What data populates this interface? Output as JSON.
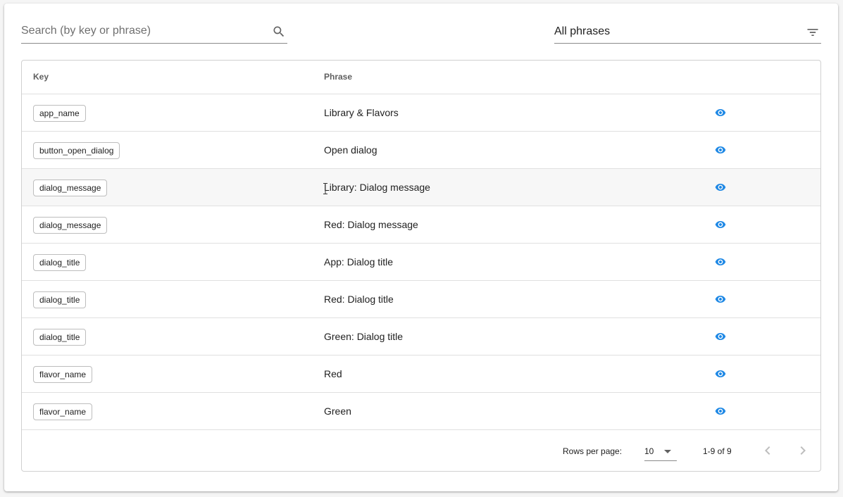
{
  "search": {
    "placeholder": "Search (by key or phrase)",
    "value": "",
    "icon": "search-icon"
  },
  "filter": {
    "selected": "All phrases",
    "icon": "filter-icon"
  },
  "table": {
    "columns": {
      "key": "Key",
      "phrase": "Phrase"
    },
    "rows": [
      {
        "key": "app_name",
        "phrase": "Library & Flavors"
      },
      {
        "key": "button_open_dialog",
        "phrase": "Open dialog"
      },
      {
        "key": "dialog_message",
        "phrase": "Library: Dialog message"
      },
      {
        "key": "dialog_message",
        "phrase": "Red: Dialog message"
      },
      {
        "key": "dialog_title",
        "phrase": "App: Dialog title"
      },
      {
        "key": "dialog_title",
        "phrase": "Red: Dialog title"
      },
      {
        "key": "dialog_title",
        "phrase": "Green: Dialog title"
      },
      {
        "key": "flavor_name",
        "phrase": "Red"
      },
      {
        "key": "flavor_name",
        "phrase": "Green"
      }
    ]
  },
  "pagination": {
    "rows_per_page_label": "Rows per page:",
    "rows_per_page": "10",
    "range": "1-9 of 9"
  },
  "colors": {
    "accent": "#1e88e5",
    "border": "#e0e0e0",
    "muted_icon": "#9e9e9e"
  }
}
